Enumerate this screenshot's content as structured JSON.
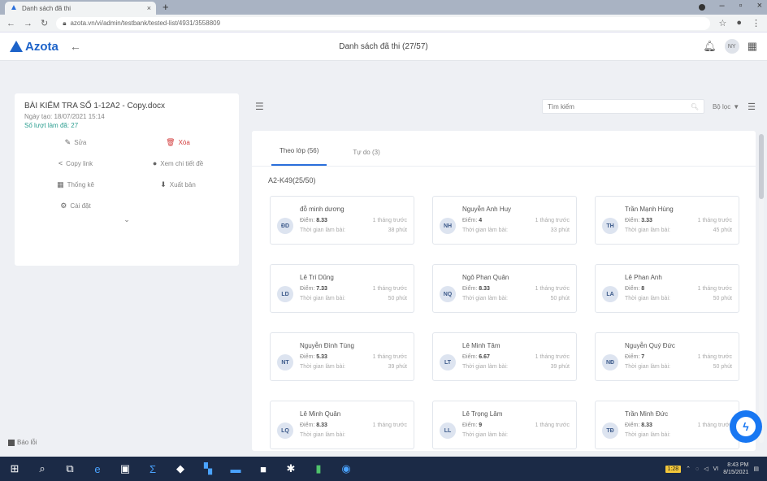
{
  "browser": {
    "tab_title": "Danh sách đã thi",
    "url": "azota.vn/vi/admin/testbank/tested-list/4931/3558809"
  },
  "header": {
    "logo": "Azota",
    "title": "Danh sách đã thi (27/57)",
    "avatar": "NY"
  },
  "test": {
    "title": "BÀI KIỂM TRA SỐ 1-12A2 - Copy.docx",
    "created": "Ngày tạo: 18/07/2021 15:14",
    "views": "Số lượt làm đã: 27"
  },
  "actions": {
    "edit": "Sửa",
    "delete": "Xóa",
    "share": "Copy link",
    "show_result": "Xem chi tiết đề",
    "stats": "Thống kê",
    "export": "Xuất bản",
    "settings": "Cài đặt"
  },
  "toolbar": {
    "search_placeholder": "Tìm kiếm",
    "filter": "Bộ lọc"
  },
  "tabs": [
    "Theo lớp (56)",
    "Tự do (3)"
  ],
  "group_label": "A2-K49(25/50)",
  "card_labels": {
    "score": "Điểm:",
    "time_label": "Thời gian làm bài:"
  },
  "students": [
    {
      "name": "đỗ minh dương",
      "initials": "ĐD",
      "score": "8.33",
      "when": "1 tháng trước",
      "duration": "38 phút"
    },
    {
      "name": "Nguyễn Anh Huy",
      "initials": "NH",
      "score": "4",
      "when": "1 tháng trước",
      "duration": "33 phút"
    },
    {
      "name": "Trần Mạnh Hùng",
      "initials": "TH",
      "score": "3.33",
      "when": "1 tháng trước",
      "duration": "45 phút"
    },
    {
      "name": "Lê Trí Dũng",
      "initials": "LD",
      "score": "7.33",
      "when": "1 tháng trước",
      "duration": "50 phút"
    },
    {
      "name": "Ngô Phan Quân",
      "initials": "NQ",
      "score": "8.33",
      "when": "1 tháng trước",
      "duration": "50 phút"
    },
    {
      "name": "Lê Phan Anh",
      "initials": "LA",
      "score": "8",
      "when": "1 tháng trước",
      "duration": "50 phút"
    },
    {
      "name": "Nguyễn Đình Tùng",
      "initials": "NT",
      "score": "5.33",
      "when": "1 tháng trước",
      "duration": "39 phút"
    },
    {
      "name": "Lê Minh Tâm",
      "initials": "LT",
      "score": "6.67",
      "when": "1 tháng trước",
      "duration": "39 phút"
    },
    {
      "name": "Nguyễn Quý Đức",
      "initials": "NĐ",
      "score": "7",
      "when": "1 tháng trước",
      "duration": "50 phút"
    },
    {
      "name": "Lê Minh Quân",
      "initials": "LQ",
      "score": "8.33",
      "when": "1 tháng trước",
      "duration": ""
    },
    {
      "name": "Lê Trọng Lâm",
      "initials": "LL",
      "score": "9",
      "when": "1 tháng trước",
      "duration": ""
    },
    {
      "name": "Trần Minh Đức",
      "initials": "TĐ",
      "score": "8.33",
      "when": "1 tháng trước",
      "duration": ""
    }
  ],
  "footer": {
    "help": "Báo lỗi"
  },
  "taskbar": {
    "battery": "1:28",
    "time": "8:43 PM",
    "date": "8/15/2021",
    "lang": "VI"
  }
}
